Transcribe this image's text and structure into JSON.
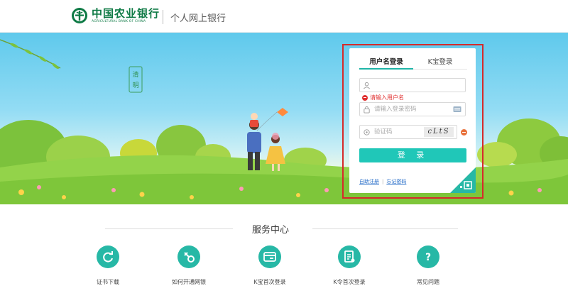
{
  "header": {
    "bank_name_cn": "中国农业银行",
    "bank_name_en": "AGRICULTURAL BANK OF CHINA",
    "site_name": "个人网上银行"
  },
  "banner": {
    "badge_text": "清明"
  },
  "login": {
    "tabs": [
      {
        "label": "用户名登录",
        "active": true
      },
      {
        "label": "K宝登录",
        "active": false
      }
    ],
    "username": {
      "value": "",
      "placeholder": ""
    },
    "username_error": "请输入用户名",
    "password": {
      "placeholder": "请输入登录密码"
    },
    "captcha_input": {
      "placeholder": "验证码"
    },
    "captcha_text": "cLtS",
    "submit_label": "登 录",
    "links": {
      "register": "自助注册",
      "forgot": "忘记密码"
    }
  },
  "service_center": {
    "title": "服务中心",
    "items": [
      {
        "label": "证书下载",
        "icon": "refresh-icon"
      },
      {
        "label": "如何开通网银",
        "icon": "key-icon"
      },
      {
        "label": "K宝首次登录",
        "icon": "card-icon"
      },
      {
        "label": "K令首次登录",
        "icon": "document-icon"
      },
      {
        "label": "常见问题",
        "icon": "question-icon"
      }
    ]
  },
  "colors": {
    "brand_green": "#0e7a45",
    "accent_teal": "#20c7b8",
    "error_red": "#e03030",
    "highlight_frame": "#d62a2a"
  }
}
